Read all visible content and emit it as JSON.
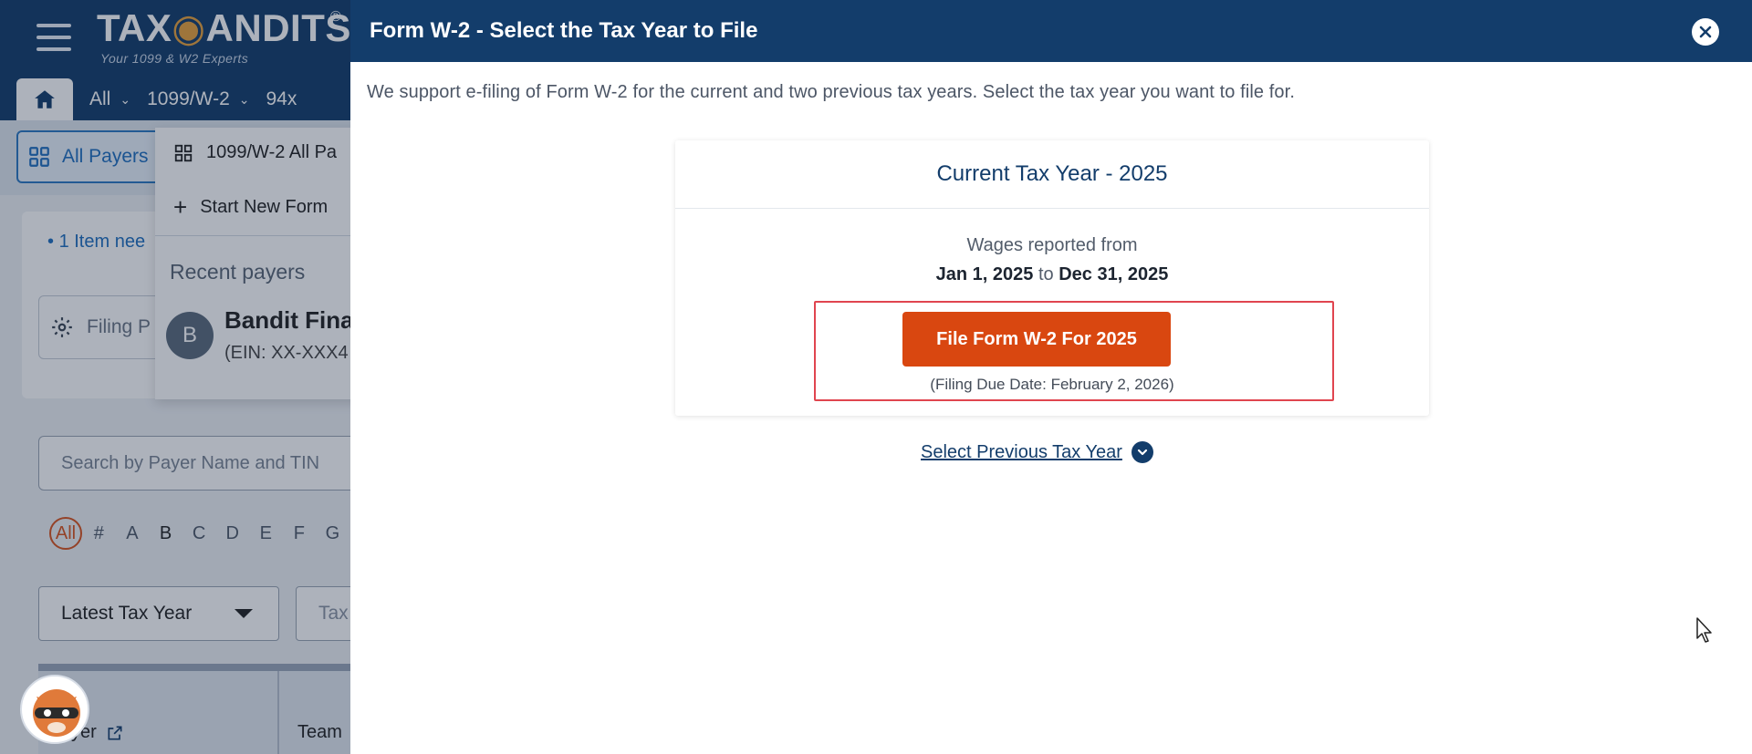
{
  "background": {
    "logo": {
      "brand_left": "TAX",
      "brand_right": "ANDITS",
      "reg": "®",
      "tagline": "Your 1099 & W2 Experts"
    },
    "nav": {
      "all": "All",
      "forms": "1099/W-2",
      "forms94x": "94x"
    },
    "all_payers": "All Payers",
    "dropdown": {
      "all_payers": "1099/W-2 All Pa",
      "start_new": "Start New Form",
      "recent_label": "Recent payers",
      "payer_initial": "B",
      "payer_name": "Bandit Fina",
      "payer_ein": "(EIN: XX-XXX4"
    },
    "items_need": "1 Item nee",
    "filing_box": "Filing P",
    "search_placeholder": "Search by Payer Name and TIN",
    "alphabet": [
      "All",
      "#",
      "A",
      "B",
      "C",
      "D",
      "E",
      "F",
      "G"
    ],
    "latest_tax_year": "Latest Tax Year",
    "tax_select": "Tax",
    "table": {
      "payer_col": "yer",
      "team_col": "Team"
    }
  },
  "modal": {
    "title": "Form W-2 - Select the Tax Year to File",
    "intro": "We support e-filing of Form W-2 for the current and two previous tax years. Select the tax year you want to file for.",
    "card_title": "Current Tax Year - 2025",
    "wages_label": "Wages reported from",
    "wages_from": "Jan 1, 2025",
    "wages_to_word": "to",
    "wages_to": "Dec 31, 2025",
    "file_button": "File Form W-2 For 2025",
    "due_date": "(Filing Due Date: February 2, 2026)",
    "previous_year_link": "Select Previous Tax Year"
  },
  "colors": {
    "header_navy": "#133d6b",
    "button_orange": "#d94710",
    "highlight_red": "#e0454f",
    "link_blue": "#1f6fbf"
  }
}
